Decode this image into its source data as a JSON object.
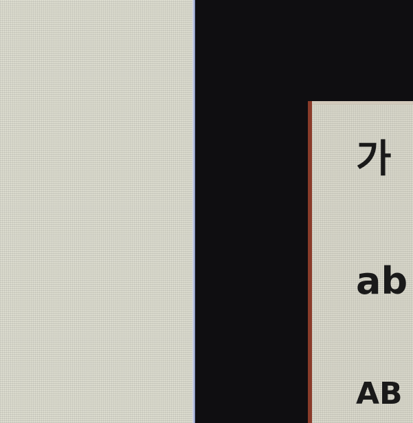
{
  "right_panel": {
    "lines": {
      "korean": "가",
      "lower": "ab",
      "upper": "AB"
    }
  }
}
